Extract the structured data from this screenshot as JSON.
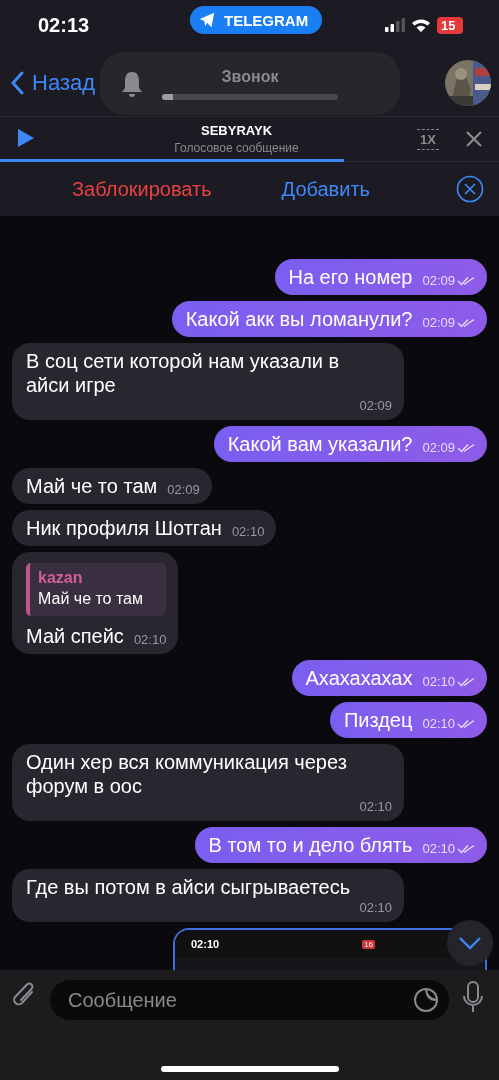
{
  "status_bar": {
    "time": "02:13",
    "app_pill": "TELEGRAM",
    "battery": "15"
  },
  "nav": {
    "back": "Назад"
  },
  "volume_overlay": {
    "label": "Звонок",
    "level": 0.06
  },
  "player": {
    "title": "SEBYRAYK",
    "subtitle": "Голосовое сообщение",
    "speed": "1X",
    "level": 0.69
  },
  "actions": {
    "block": "Заблокировать",
    "add": "Добавить"
  },
  "messages": [
    {
      "outgoing": true,
      "text": "На его номер",
      "time": "02:09",
      "read": true
    },
    {
      "outgoing": true,
      "text": "Какой акк вы ломанули?",
      "time": "02:09",
      "read": true
    },
    {
      "outgoing": false,
      "text": "В соц сети которой нам указали в айси игре",
      "time": "02:09"
    },
    {
      "outgoing": true,
      "text": "Какой вам указали?",
      "time": "02:09",
      "read": true
    },
    {
      "outgoing": false,
      "text": "Май че то там",
      "time": "02:09"
    },
    {
      "outgoing": false,
      "text": "Ник профиля Шотган",
      "time": "02:10"
    },
    {
      "outgoing": false,
      "text": "Май спейс",
      "time": "02:10",
      "reply": {
        "name": "kazan",
        "text": "Май че то там"
      }
    },
    {
      "outgoing": true,
      "text": "Ахахахахах",
      "time": "02:10",
      "read": true
    },
    {
      "outgoing": true,
      "text": "Пиздец",
      "time": "02:10",
      "read": true
    },
    {
      "outgoing": false,
      "text": "Один хер вся коммуникация через форум в оос",
      "time": "02:10"
    },
    {
      "outgoing": true,
      "text": "В том то и дело блять",
      "time": "02:10",
      "read": true
    },
    {
      "outgoing": false,
      "text": "Где вы потом в айси сыгрываетесь",
      "time": "02:10"
    }
  ],
  "attachment": {
    "time": "02:10",
    "battery": "16"
  },
  "composer": {
    "placeholder": "Сообщение"
  }
}
